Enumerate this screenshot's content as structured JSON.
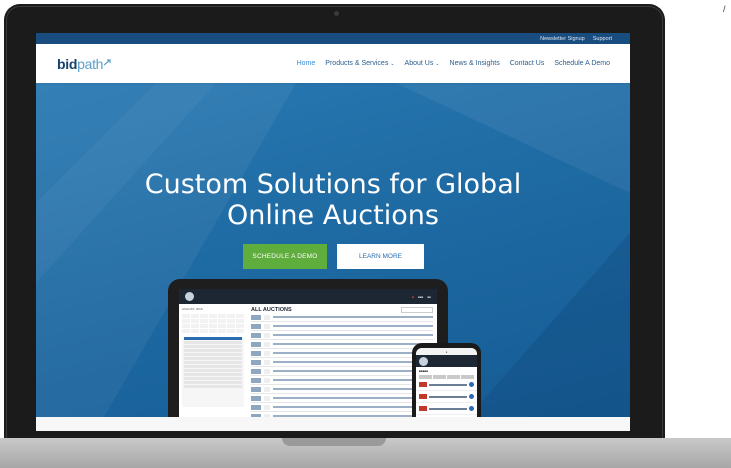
{
  "topbar": {
    "newsletter": "Newsletter Signup",
    "support": "Support"
  },
  "logo": {
    "bid": "bid",
    "path": "path"
  },
  "nav": {
    "home": "Home",
    "products": "Products & Services",
    "about": "About Us",
    "news": "News & Insights",
    "contact": "Contact Us",
    "demo": "Schedule A Demo"
  },
  "hero": {
    "title_line1": "Custom Solutions for Global",
    "title_line2": "Online Auctions",
    "cta_demo": "SCHEDULE A DEMO",
    "cta_learn": "LEARN MORE"
  },
  "tablet": {
    "heading": "ALL AUCTIONS",
    "calendar_label": "AUGUST, 2019"
  },
  "colors": {
    "brand_navy": "#17406b",
    "hero_blue": "#1e6aa3",
    "cta_green": "#5fad3c",
    "nav_active": "#3a8bd6"
  }
}
